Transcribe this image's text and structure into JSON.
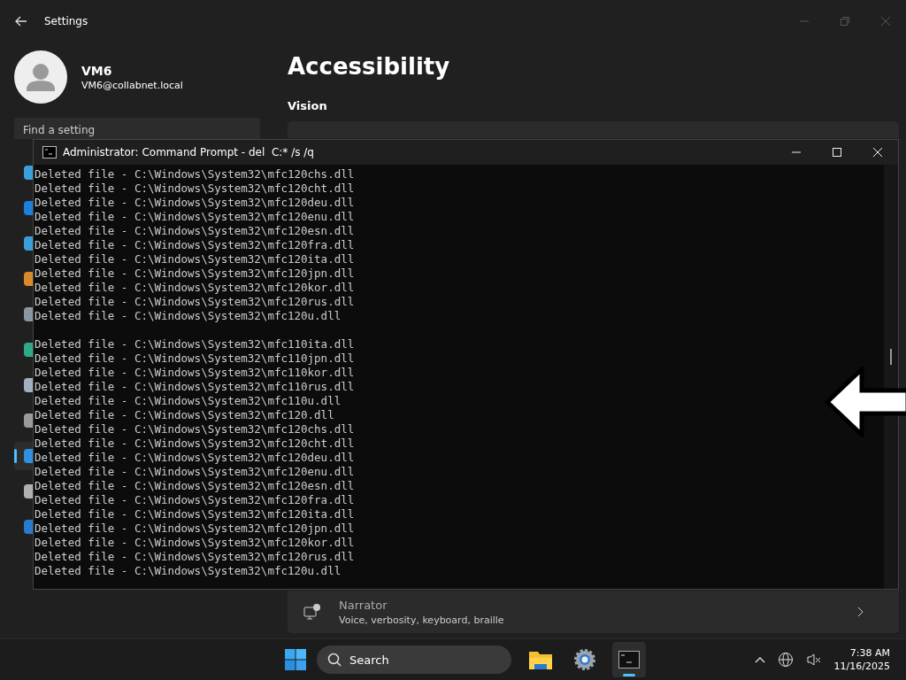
{
  "settings": {
    "title": "Settings",
    "user": {
      "name": "VM6",
      "email": "VM6@collabnet.local"
    },
    "search": {
      "placeholder": "Find a setting"
    },
    "nav_items": [
      {
        "color": "#3aa0d8",
        "selected": false
      },
      {
        "color": "#1e7fd8",
        "selected": false
      },
      {
        "color": "#3b9ed8",
        "selected": false
      },
      {
        "color": "#d88a2a",
        "selected": false
      },
      {
        "color": "#8a96a0",
        "selected": false
      },
      {
        "color": "#2eaa88",
        "selected": false
      },
      {
        "color": "#a0b0c0",
        "selected": false
      },
      {
        "color": "#9a9a9a",
        "selected": false
      },
      {
        "color": "#2f8fe0",
        "selected": true
      },
      {
        "color": "#b0b0b0",
        "selected": false
      },
      {
        "color": "#2b7ad0",
        "selected": false
      }
    ],
    "page_title": "Accessibility",
    "section": "Vision",
    "narrator": {
      "title": "Narrator",
      "subtitle": "Voice, verbosity, keyboard, braille"
    }
  },
  "console": {
    "title": "Administrator: Command Prompt - del  C:* /s /q",
    "blocks": [
      [
        "Deleted file - C:\\Windows\\System32\\mfc120chs.dll",
        "Deleted file - C:\\Windows\\System32\\mfc120cht.dll",
        "Deleted file - C:\\Windows\\System32\\mfc120deu.dll",
        "Deleted file - C:\\Windows\\System32\\mfc120enu.dll",
        "Deleted file - C:\\Windows\\System32\\mfc120esn.dll",
        "Deleted file - C:\\Windows\\System32\\mfc120fra.dll",
        "Deleted file - C:\\Windows\\System32\\mfc120ita.dll",
        "Deleted file - C:\\Windows\\System32\\mfc120jpn.dll",
        "Deleted file - C:\\Windows\\System32\\mfc120kor.dll",
        "Deleted file - C:\\Windows\\System32\\mfc120rus.dll",
        "Deleted file - C:\\Windows\\System32\\mfc120u.dll"
      ],
      [
        "Deleted file - C:\\Windows\\System32\\mfc110ita.dll",
        "Deleted file - C:\\Windows\\System32\\mfc110jpn.dll",
        "Deleted file - C:\\Windows\\System32\\mfc110kor.dll",
        "Deleted file - C:\\Windows\\System32\\mfc110rus.dll",
        "Deleted file - C:\\Windows\\System32\\mfc110u.dll",
        "Deleted file - C:\\Windows\\System32\\mfc120.dll",
        "Deleted file - C:\\Windows\\System32\\mfc120chs.dll",
        "Deleted file - C:\\Windows\\System32\\mfc120cht.dll",
        "Deleted file - C:\\Windows\\System32\\mfc120deu.dll",
        "Deleted file - C:\\Windows\\System32\\mfc120enu.dll",
        "Deleted file - C:\\Windows\\System32\\mfc120esn.dll",
        "Deleted file - C:\\Windows\\System32\\mfc120fra.dll",
        "Deleted file - C:\\Windows\\System32\\mfc120ita.dll",
        "Deleted file - C:\\Windows\\System32\\mfc120jpn.dll",
        "Deleted file - C:\\Windows\\System32\\mfc120kor.dll",
        "Deleted file - C:\\Windows\\System32\\mfc120rus.dll",
        "Deleted file - C:\\Windows\\System32\\mfc120u.dll"
      ]
    ]
  },
  "taskbar": {
    "search": "Search",
    "apps": [
      {
        "kind": "explorer",
        "selected": false
      },
      {
        "kind": "settings",
        "selected": false
      },
      {
        "kind": "terminal",
        "selected": true
      }
    ],
    "time": "7:38 AM",
    "date": "11/16/2025"
  }
}
